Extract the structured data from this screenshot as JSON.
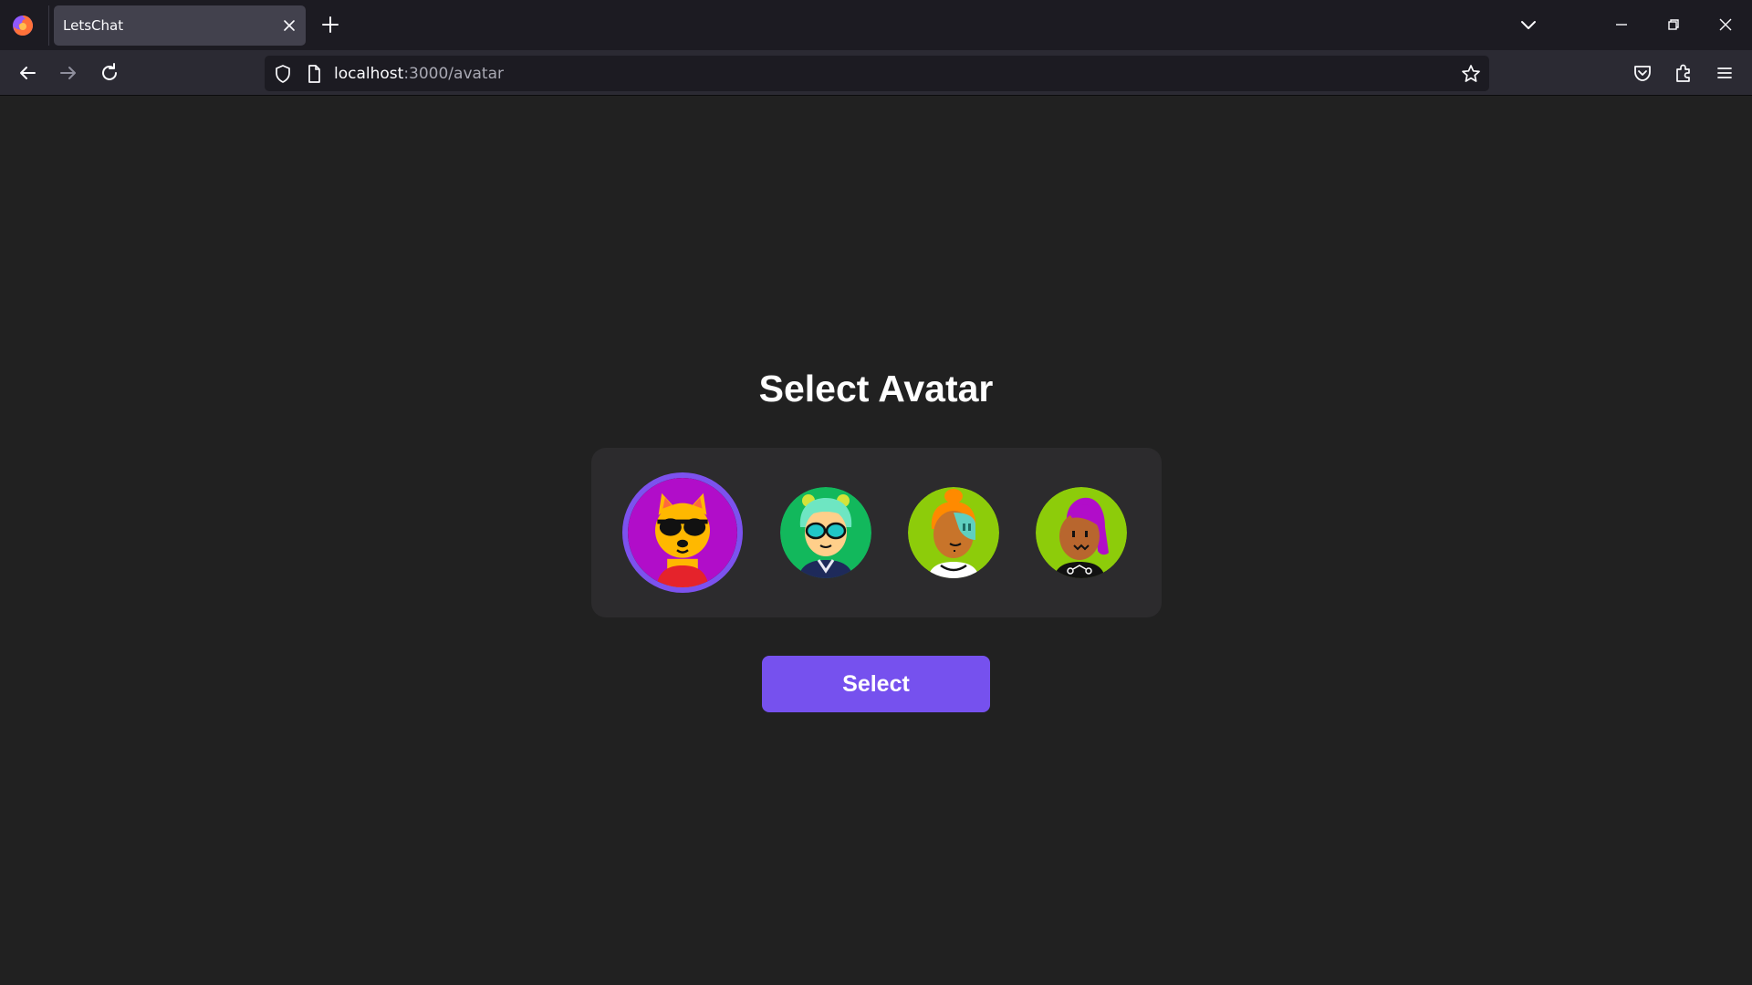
{
  "browser": {
    "tab_title": "LetsChat",
    "url_host": "localhost",
    "url_path": ":3000/avatar"
  },
  "page": {
    "heading": "Select Avatar",
    "select_button": "Select",
    "selected_avatar_index": 0
  },
  "colors": {
    "accent": "#7651ee",
    "page_background": "#212121",
    "panel_background": "#2c2b2d"
  }
}
